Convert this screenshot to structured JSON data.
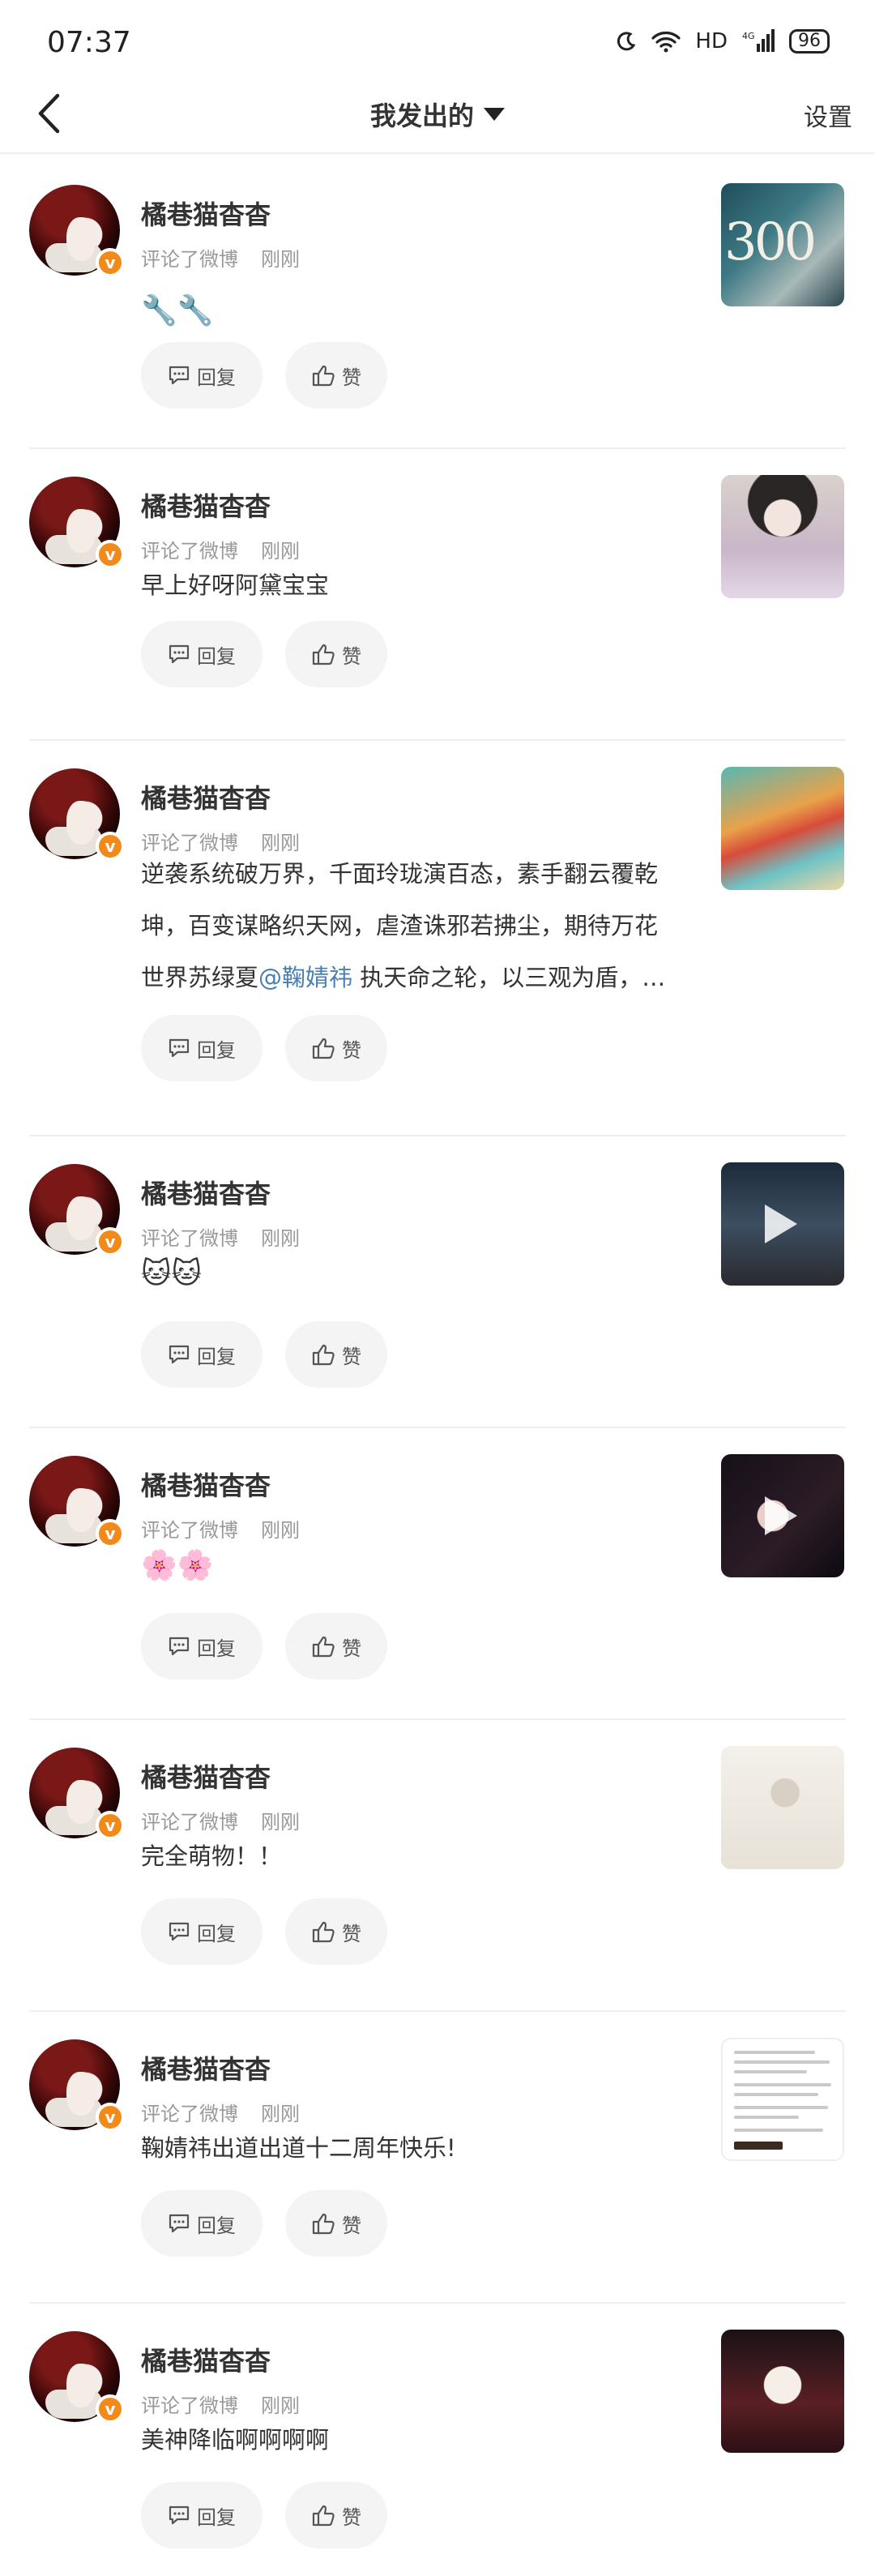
{
  "status_bar": {
    "time": "07:37",
    "net_label": "HD",
    "battery": "96"
  },
  "nav": {
    "title": "我发出的",
    "settings": "设置"
  },
  "actions": {
    "reply": "回复",
    "like": "赞"
  },
  "items": [
    {
      "user": "橘巷猫杳杳",
      "action": "评论了微博",
      "time": "刚刚",
      "content": "🔧🔧",
      "thumb": "image",
      "thumb_text": "300"
    },
    {
      "user": "橘巷猫杳杳",
      "action": "评论了微博",
      "time": "刚刚",
      "content": "早上好呀阿黛宝宝",
      "thumb": "image"
    },
    {
      "user": "橘巷猫杳杳",
      "action": "评论了微博",
      "time": "刚刚",
      "content_line1": "逆袭系统破万界，千面玲珑演百态，素手翻云覆乾",
      "content_line2": "坤，百变谋略织天网，虐渣诛邪若拂尘，期待万花",
      "content_line3_a": "世界苏绿夏",
      "content_mention": "@鞠婧祎",
      "content_line3_b": " 执天命之轮，以三观为盾，…",
      "thumb": "image"
    },
    {
      "user": "橘巷猫杳杳",
      "action": "评论了微博",
      "time": "刚刚",
      "content": "🐱🐱",
      "thumb": "video"
    },
    {
      "user": "橘巷猫杳杳",
      "action": "评论了微博",
      "time": "刚刚",
      "content": "🌸🌸",
      "thumb": "video"
    },
    {
      "user": "橘巷猫杳杳",
      "action": "评论了微博",
      "time": "刚刚",
      "content": "完全萌物！！",
      "thumb": "image"
    },
    {
      "user": "橘巷猫杳杳",
      "action": "评论了微博",
      "time": "刚刚",
      "content": "鞠婧祎出道出道十二周年快乐!",
      "thumb": "document"
    },
    {
      "user": "橘巷猫杳杳",
      "action": "评论了微博",
      "time": "刚刚",
      "content": "美神降临啊啊啊啊",
      "thumb": "image"
    }
  ],
  "colors": {
    "verify_badge": "#f28a1a",
    "mention": "#4a7fb3",
    "meta": "#999999"
  }
}
